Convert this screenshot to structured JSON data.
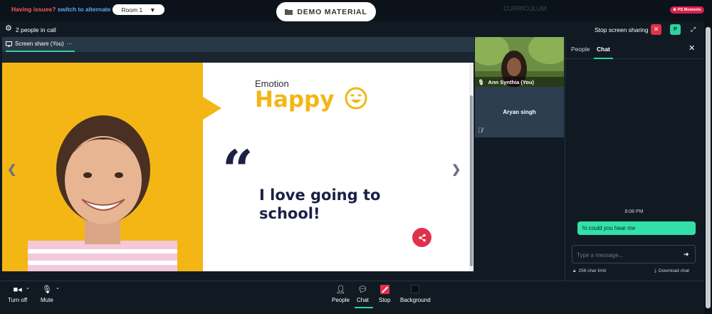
{
  "topbar": {
    "issues_prefix": "Having issues?",
    "issues_link": "switch to alternate room",
    "room_value": "Room 1",
    "demo_label": "DEMO MATERIAL",
    "curriculum_label": "CURRICULUM",
    "moments_label": "PS Moments"
  },
  "callbar": {
    "people_count": "2 people in call",
    "stop_sharing_label": "Stop screen sharing",
    "p_badge": "P"
  },
  "share": {
    "tab_label": "Screen share (You)",
    "tab_more": "···"
  },
  "slide": {
    "emotion_label": "Emotion",
    "emotion_value": "Happy",
    "quote_mark": "“",
    "quote_text": "I love going to school!"
  },
  "participants": [
    {
      "name": "Ann Synthia (You)"
    },
    {
      "name": "Aryan singh"
    }
  ],
  "sidepanel": {
    "tabs": [
      "People",
      "Chat"
    ],
    "active_tab": "Chat",
    "messages": [
      {
        "time": "8:08 PM",
        "text": "hi could you hear me"
      }
    ],
    "input_placeholder": "Type a message...",
    "char_limit": "256 char limit",
    "download_label": "Download chat"
  },
  "controls": {
    "turn_off": "Turn off",
    "mute": "Mute",
    "people": "People",
    "chat": "Chat",
    "stop": "Stop",
    "background": "Background"
  },
  "colors": {
    "accent": "#2cd39f",
    "danger": "#e0314b",
    "slide_yellow": "#f3b614",
    "slide_navy": "#1c2046"
  }
}
